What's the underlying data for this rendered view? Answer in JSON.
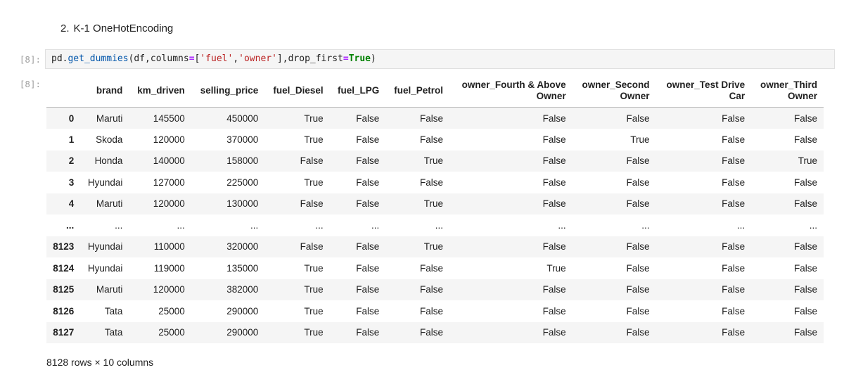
{
  "markdown": {
    "number": "2.",
    "text": "K-1 OneHotEncoding"
  },
  "cell": {
    "input_prompt": "[8]:",
    "output_prompt": "[8]:",
    "code": {
      "obj": "pd",
      "dot": ".",
      "fn": "get_dummies",
      "open": "(",
      "arg1": "df,columns",
      "eq1": "=",
      "bracket_open": "[",
      "str1": "'fuel'",
      "comma": ",",
      "str2": "'owner'",
      "bracket_close": "],drop_first",
      "eq2": "=",
      "kw": "True",
      "close": ")"
    }
  },
  "table": {
    "columns": [
      {
        "line1": "",
        "line2": ""
      },
      {
        "line1": "brand",
        "line2": ""
      },
      {
        "line1": "km_driven",
        "line2": ""
      },
      {
        "line1": "selling_price",
        "line2": ""
      },
      {
        "line1": "fuel_Diesel",
        "line2": ""
      },
      {
        "line1": "fuel_LPG",
        "line2": ""
      },
      {
        "line1": "fuel_Petrol",
        "line2": ""
      },
      {
        "line1": "owner_Fourth & Above",
        "line2": "Owner"
      },
      {
        "line1": "owner_Second",
        "line2": "Owner"
      },
      {
        "line1": "owner_Test Drive",
        "line2": "Car"
      },
      {
        "line1": "owner_Third",
        "line2": "Owner"
      }
    ],
    "rows": [
      [
        "0",
        "Maruti",
        "145500",
        "450000",
        "True",
        "False",
        "False",
        "False",
        "False",
        "False",
        "False"
      ],
      [
        "1",
        "Skoda",
        "120000",
        "370000",
        "True",
        "False",
        "False",
        "False",
        "True",
        "False",
        "False"
      ],
      [
        "2",
        "Honda",
        "140000",
        "158000",
        "False",
        "False",
        "True",
        "False",
        "False",
        "False",
        "True"
      ],
      [
        "3",
        "Hyundai",
        "127000",
        "225000",
        "True",
        "False",
        "False",
        "False",
        "False",
        "False",
        "False"
      ],
      [
        "4",
        "Maruti",
        "120000",
        "130000",
        "False",
        "False",
        "True",
        "False",
        "False",
        "False",
        "False"
      ],
      [
        "...",
        "...",
        "...",
        "...",
        "...",
        "...",
        "...",
        "...",
        "...",
        "...",
        "..."
      ],
      [
        "8123",
        "Hyundai",
        "110000",
        "320000",
        "False",
        "False",
        "True",
        "False",
        "False",
        "False",
        "False"
      ],
      [
        "8124",
        "Hyundai",
        "119000",
        "135000",
        "True",
        "False",
        "False",
        "True",
        "False",
        "False",
        "False"
      ],
      [
        "8125",
        "Maruti",
        "120000",
        "382000",
        "True",
        "False",
        "False",
        "False",
        "False",
        "False",
        "False"
      ],
      [
        "8126",
        "Tata",
        "25000",
        "290000",
        "True",
        "False",
        "False",
        "False",
        "False",
        "False",
        "False"
      ],
      [
        "8127",
        "Tata",
        "25000",
        "290000",
        "True",
        "False",
        "False",
        "False",
        "False",
        "False",
        "False"
      ]
    ]
  },
  "shape_text": "8128 rows × 10 columns"
}
